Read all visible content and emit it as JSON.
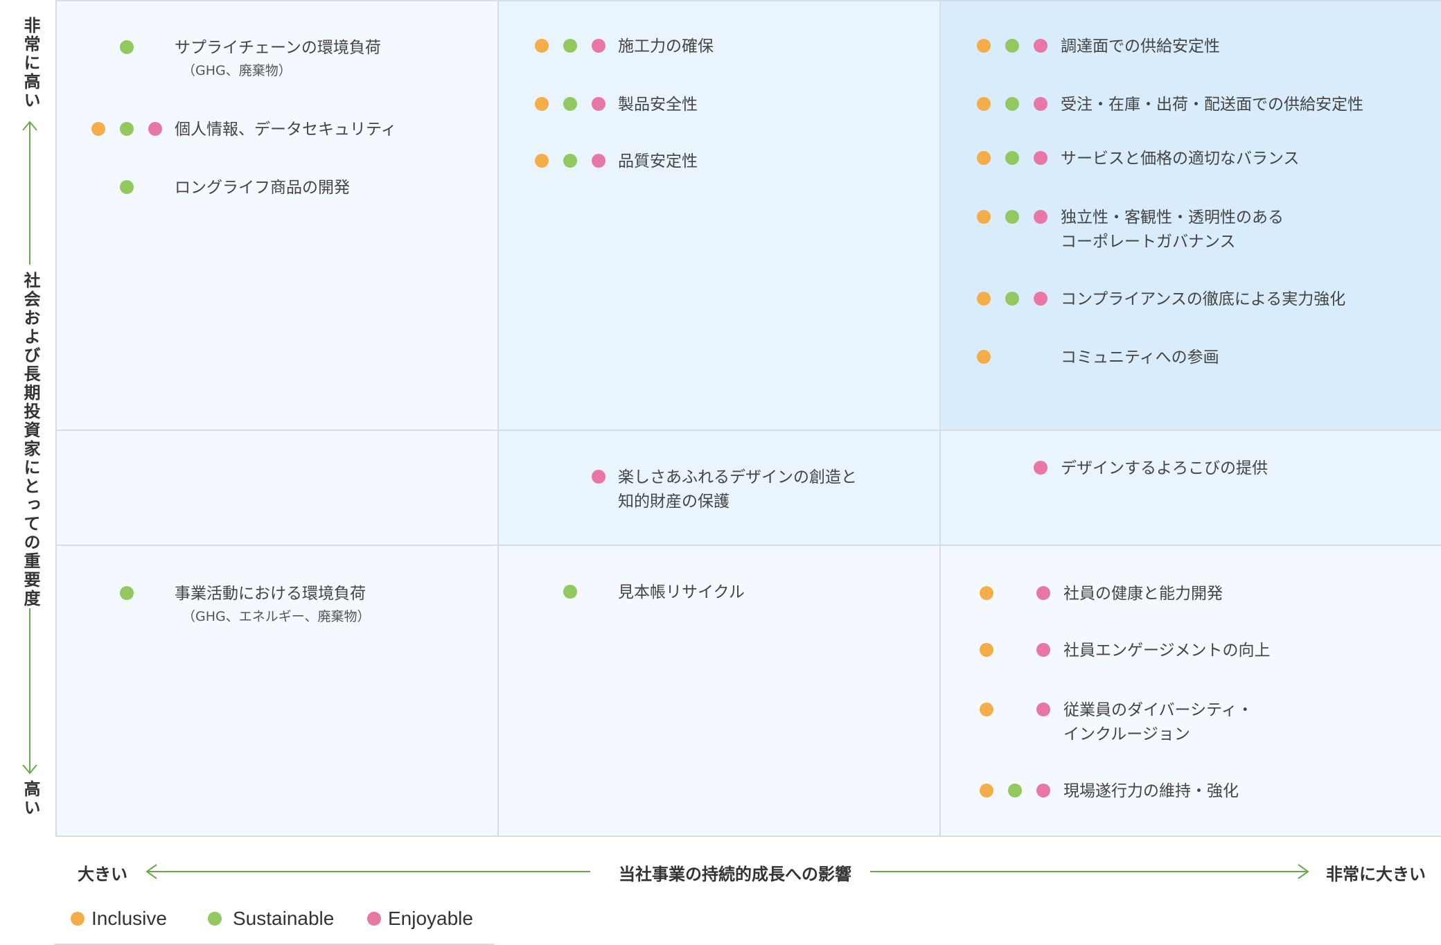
{
  "colors": {
    "inclusive": "#f5ad4a",
    "sustainable": "#91c95e",
    "enjoyable": "#e877a6",
    "cell_light": "#f3f9fe",
    "cell_mid": "#e9f4fd",
    "cell_strong": "#d9ecfb",
    "arrow": "#6aa84f"
  },
  "y_axis": {
    "top": "非常に高い",
    "middle": "社会および長期投資家にとっての重要度",
    "bottom": "高い"
  },
  "x_axis": {
    "left": "大きい",
    "middle": "当社事業の持続的成長への影響",
    "right": "非常に大きい"
  },
  "legend": [
    {
      "key": "inclusive",
      "label": "Inclusive"
    },
    {
      "key": "sustainable",
      "label": "Sustainable"
    },
    {
      "key": "enjoyable",
      "label": "Enjoyable"
    }
  ],
  "cells": {
    "top_left": [
      {
        "label": "サプライチェーンの環境負荷",
        "sub": "（GHG、廃棄物）",
        "tags": [
          "sustainable"
        ]
      },
      {
        "label": "個人情報、データセキュリティ",
        "tags": [
          "inclusive",
          "sustainable",
          "enjoyable"
        ]
      },
      {
        "label": "ロングライフ商品の開発",
        "tags": [
          "sustainable"
        ]
      }
    ],
    "top_mid": [
      {
        "label": "施工力の確保",
        "tags": [
          "inclusive",
          "sustainable",
          "enjoyable"
        ]
      },
      {
        "label": "製品安全性",
        "tags": [
          "inclusive",
          "sustainable",
          "enjoyable"
        ]
      },
      {
        "label": "品質安定性",
        "tags": [
          "inclusive",
          "sustainable",
          "enjoyable"
        ]
      }
    ],
    "top_right": [
      {
        "label": "調達面での供給安定性",
        "tags": [
          "inclusive",
          "sustainable",
          "enjoyable"
        ]
      },
      {
        "label": "受注・在庫・出荷・配送面での供給安定性",
        "tags": [
          "inclusive",
          "sustainable",
          "enjoyable"
        ]
      },
      {
        "label": "サービスと価格の適切なバランス",
        "tags": [
          "inclusive",
          "sustainable",
          "enjoyable"
        ]
      },
      {
        "label": "独立性・客観性・透明性のある",
        "label2": "コーポレートガバナンス",
        "tags": [
          "inclusive",
          "sustainable",
          "enjoyable"
        ]
      },
      {
        "label": "コンプライアンスの徹底による実力強化",
        "tags": [
          "inclusive",
          "sustainable",
          "enjoyable"
        ]
      },
      {
        "label": "コミュニティへの参画",
        "tags": [
          "inclusive"
        ]
      }
    ],
    "mid_mid": [
      {
        "label": "楽しさあふれるデザインの創造と",
        "label2": "知的財産の保護",
        "tags": [
          "enjoyable"
        ]
      }
    ],
    "mid_right": [
      {
        "label": "デザインするよろこびの提供",
        "tags": [
          "enjoyable"
        ]
      }
    ],
    "bottom_left": [
      {
        "label": "事業活動における環境負荷",
        "sub": "（GHG、エネルギー、廃棄物）",
        "tags": [
          "sustainable"
        ]
      }
    ],
    "bottom_mid": [
      {
        "label": "見本帳リサイクル",
        "tags": [
          "sustainable"
        ]
      }
    ],
    "bottom_right": [
      {
        "label": "社員の健康と能力開発",
        "tags": [
          "inclusive",
          "enjoyable"
        ]
      },
      {
        "label": "社員エンゲージメントの向上",
        "tags": [
          "inclusive",
          "enjoyable"
        ]
      },
      {
        "label": "従業員のダイバーシティ・",
        "label2": "インクルージョン",
        "tags": [
          "inclusive",
          "enjoyable"
        ]
      },
      {
        "label": "現場遂行力の維持・強化",
        "tags": [
          "inclusive",
          "sustainable",
          "enjoyable"
        ]
      }
    ]
  }
}
